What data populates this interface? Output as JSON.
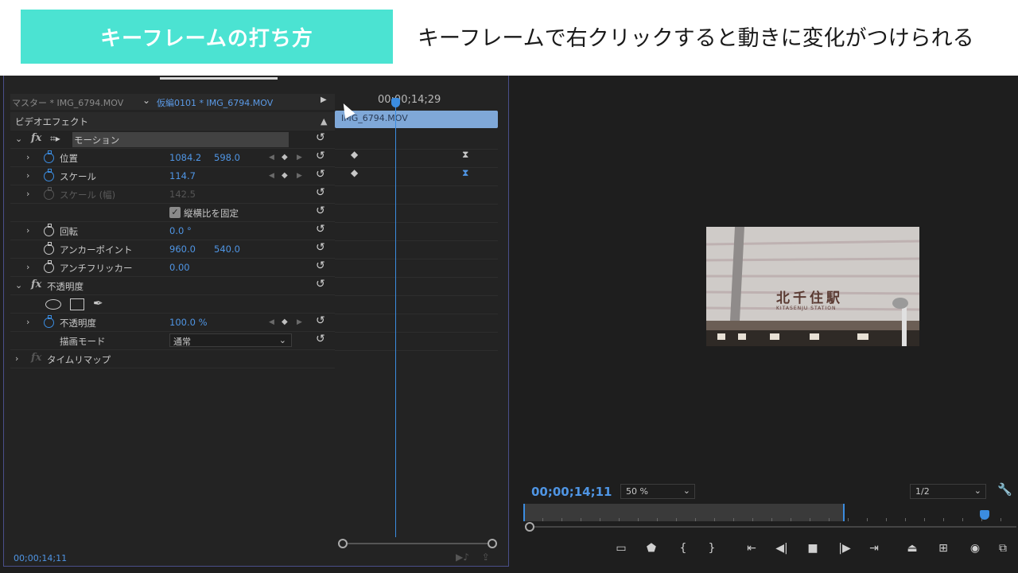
{
  "banner": {
    "tag": "キーフレームの打ち方",
    "caption": "キーフレームで右クリックすると動きに変化がつけられる"
  },
  "colors": {
    "accent": "#4be3d2",
    "timecode_blue": "#4f95e4"
  },
  "effect_controls": {
    "master_label": "マスター * IMG_6794.MOV",
    "sequence_label": "仮編0101 * IMG_6794.MOV",
    "ruler_timecode": "00;00;14;29",
    "clip_name": "IMG_6794.MOV",
    "section_video": "ビデオエフェクト",
    "motion": {
      "title": "モーション",
      "position_label": "位置",
      "position_x": "1084.2",
      "position_y": "598.0",
      "scale_label": "スケール",
      "scale_value": "114.7",
      "scale_width_label": "スケール (幅)",
      "scale_width_value": "142.5",
      "uniform_label": "縦横比を固定",
      "rotation_label": "回転",
      "rotation_value": "0.0 °",
      "anchor_label": "アンカーポイント",
      "anchor_x": "960.0",
      "anchor_y": "540.0",
      "flicker_label": "アンチフリッカー",
      "flicker_value": "0.00"
    },
    "opacity": {
      "title": "不透明度",
      "opacity_label": "不透明度",
      "opacity_value": "100.0 %",
      "blend_label": "描画モード",
      "blend_value": "通常"
    },
    "time_remap": "タイムリマップ",
    "current_timecode": "00;00;14;11"
  },
  "program_monitor": {
    "timecode": "00;00;14;11",
    "zoom": "50 %",
    "resolution": "1/2",
    "sign_kanji": "北千住駅",
    "sign_roman": "KITASENJU STATION"
  }
}
